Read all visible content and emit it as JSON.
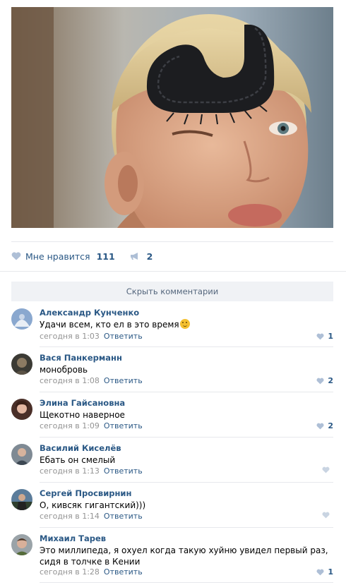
{
  "post": {
    "image_alt_icon": "photo-boy-with-millipede"
  },
  "actions": {
    "like_label": "Мне нравится",
    "like_count": "111",
    "share_count": "2"
  },
  "hide_comments_label": "Скрыть комментарии",
  "comments": [
    {
      "author": "Александр Кунченко",
      "text": "Удачи всем, кто ел в это время",
      "time": "сегодня в 1:03",
      "reply": "Ответить",
      "likes": "1",
      "has_emoji": true
    },
    {
      "author": "Вася Панкерманн",
      "text": "монобровь",
      "time": "сегодня в 1:08",
      "reply": "Ответить",
      "likes": "2"
    },
    {
      "author": "Элина Гайсановна",
      "text": "Щекотно наверное",
      "time": "сегодня в 1:09",
      "reply": "Ответить",
      "likes": "2"
    },
    {
      "author": "Василий Киселёв",
      "text": "Ебать он смелый",
      "time": "сегодня в 1:13",
      "reply": "Ответить",
      "likes": ""
    },
    {
      "author": "Сергей Просвирнин",
      "text": "О, кивсяк гигантский)))",
      "time": "сегодня в 1:14",
      "reply": "Ответить",
      "likes": ""
    },
    {
      "author": "Михаил Тарев",
      "text": "Это миллипеда, я охуел когда такую хуйню увидел первый раз, сидя в толчке в Кении",
      "time": "сегодня в 1:28",
      "reply": "Ответить",
      "likes": "1"
    }
  ],
  "colors": {
    "link": "#2a5885",
    "meta": "#939393",
    "divider": "#e7e8ec",
    "button_bg": "#f0f2f5",
    "like_icon": "#aebfd6"
  }
}
